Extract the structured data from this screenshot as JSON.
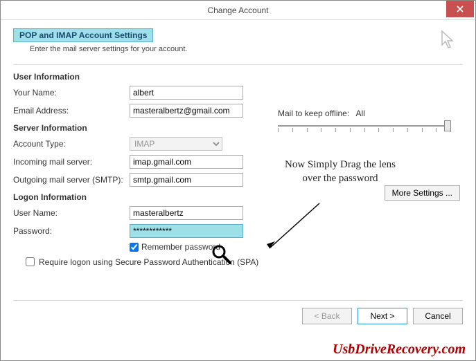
{
  "window": {
    "title": "Change Account"
  },
  "header": {
    "title": "POP and IMAP Account Settings",
    "subtitle": "Enter the mail server settings for your account."
  },
  "sections": {
    "user_info": "User Information",
    "server_info": "Server Information",
    "logon_info": "Logon Information"
  },
  "labels": {
    "your_name": "Your Name:",
    "email": "Email Address:",
    "account_type": "Account Type:",
    "incoming": "Incoming mail server:",
    "outgoing": "Outgoing mail server (SMTP):",
    "user_name": "User Name:",
    "password": "Password:",
    "remember_pw": "Remember password",
    "require_spa": "Require logon using Secure Password Authentication (SPA)",
    "mail_keep": "Mail to keep offline:",
    "mail_keep_value": "All"
  },
  "values": {
    "your_name": "albert",
    "email": "masteralbertz@gmail.com",
    "account_type": "IMAP",
    "incoming": "imap.gmail.com",
    "outgoing": "smtp.gmail.com",
    "user_name": "masteralbertz",
    "password": "************"
  },
  "buttons": {
    "more_settings": "More Settings ...",
    "back": "< Back",
    "next": "Next >",
    "cancel": "Cancel"
  },
  "annotation": "Now Simply Drag the lens over the password",
  "watermark": "UsbDriveRecovery.com"
}
